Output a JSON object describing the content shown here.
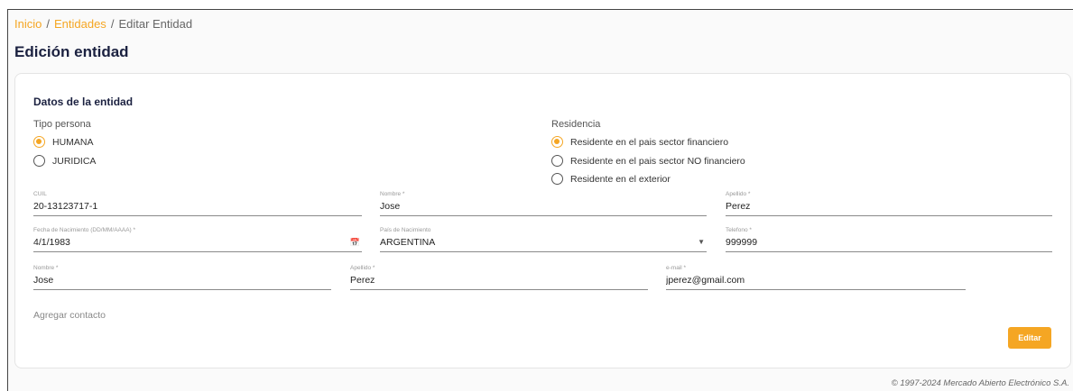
{
  "breadcrumb": {
    "home": "Inicio",
    "entities": "Entidades",
    "separator": "/",
    "current": "Editar Entidad"
  },
  "page_title": "Edición entidad",
  "section_title": "Datos de la entidad",
  "tipo_persona": {
    "label": "Tipo persona",
    "options": [
      {
        "label": "HUMANA",
        "checked": true
      },
      {
        "label": "JURIDICA",
        "checked": false
      }
    ]
  },
  "residencia": {
    "label": "Residencia",
    "options": [
      {
        "label": "Residente en el pais sector financiero",
        "checked": true
      },
      {
        "label": "Residente en el pais sector NO financiero",
        "checked": false
      },
      {
        "label": "Residente en el exterior",
        "checked": false
      }
    ]
  },
  "fields": {
    "cuil": {
      "label": "CUIL",
      "value": "20-13123717-1"
    },
    "nombre": {
      "label": "Nombre *",
      "value": "Jose"
    },
    "apellido": {
      "label": "Apellido *",
      "value": "Perez"
    },
    "fecha_nacimiento": {
      "label": "Fecha de Nacimiento (DD/MM/AAAA) *",
      "value": "4/1/1983"
    },
    "pais_nacimiento": {
      "label": "País de Nacimiento",
      "value": "ARGENTINA"
    },
    "telefono": {
      "label": "Telefono *",
      "value": "999999"
    }
  },
  "contact": {
    "nombre": {
      "label": "Nombre *",
      "value": "Jose"
    },
    "apellido": {
      "label": "Apellido *",
      "value": "Perez"
    },
    "email": {
      "label": "e-mail *",
      "value": "jperez@gmail.com"
    }
  },
  "add_contact_label": "Agregar contacto",
  "edit_button_label": "Editar",
  "footer": "© 1997-2024 Mercado Abierto Electrónico S.A.",
  "icons": {
    "calendar": "calendar-icon",
    "dropdown": "chevron-down-icon"
  },
  "colors": {
    "accent": "#f5a623",
    "title": "#1b2140"
  }
}
